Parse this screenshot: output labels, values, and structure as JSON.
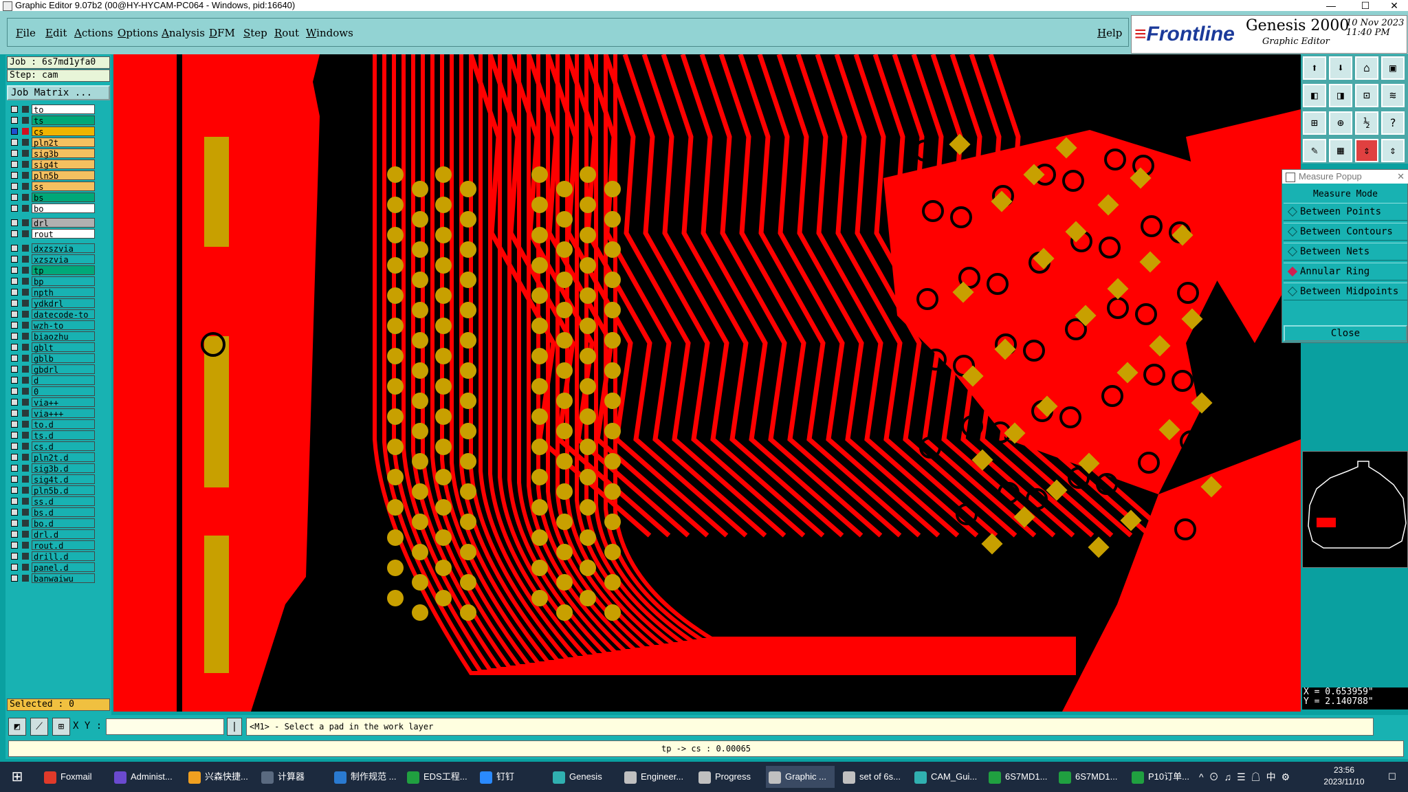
{
  "window": {
    "title": "Graphic Editor 9.07b2 (00@HY-HYCAM-PC064 - Windows, pid:16640)",
    "min": "—",
    "max": "☐",
    "close": "✕"
  },
  "menu": [
    "File",
    "Edit",
    "Actions",
    "Options",
    "Analysis",
    "DFM",
    "Step",
    "Rout",
    "Windows"
  ],
  "help": "Help",
  "brand": {
    "logo": "Frontline",
    "product": "Genesis 2000",
    "subtitle": "Graphic Editor",
    "date": "10 Nov 2023",
    "time": "11:40 PM"
  },
  "job": {
    "job_line": "Job : 6s7md1yfa0",
    "step_line": "Step: cam",
    "matrix_btn": "Job Matrix ..."
  },
  "layers_group1": [
    {
      "name": "to",
      "color": "#ffffff"
    },
    {
      "name": "ts",
      "color": "#00a878"
    },
    {
      "name": "cs",
      "color": "#f0b400",
      "active": true
    },
    {
      "name": "pln2t",
      "color": "#f4c060"
    },
    {
      "name": "sig3b",
      "color": "#f4c060"
    },
    {
      "name": "sig4t",
      "color": "#f4c060"
    },
    {
      "name": "pln5b",
      "color": "#f4c060"
    },
    {
      "name": "ss",
      "color": "#f4c060"
    },
    {
      "name": "bs",
      "color": "#00a878"
    },
    {
      "name": "bo",
      "color": "#ffffff"
    }
  ],
  "layers_group2": [
    {
      "name": "drl",
      "color": "#b0b0b0"
    },
    {
      "name": "rout",
      "color": "#ffffff"
    }
  ],
  "layers_group3": [
    {
      "name": "dxzszvia"
    },
    {
      "name": "xzszvia"
    },
    {
      "name": "tp",
      "color": "#00a878"
    },
    {
      "name": "bp"
    },
    {
      "name": "npth"
    },
    {
      "name": "ydkdrl"
    },
    {
      "name": "datecode-to"
    },
    {
      "name": "wzh-to"
    },
    {
      "name": "biaozhu"
    },
    {
      "name": "gblt"
    },
    {
      "name": "gblb"
    },
    {
      "name": "gbdrl"
    },
    {
      "name": "d"
    },
    {
      "name": "0"
    },
    {
      "name": "via++"
    },
    {
      "name": "via+++"
    },
    {
      "name": "to.d"
    },
    {
      "name": "ts.d"
    },
    {
      "name": "cs.d"
    },
    {
      "name": "pln2t.d"
    },
    {
      "name": "sig3b.d"
    },
    {
      "name": "sig4t.d"
    },
    {
      "name": "pln5b.d"
    },
    {
      "name": "ss.d"
    },
    {
      "name": "bs.d"
    },
    {
      "name": "bo.d"
    },
    {
      "name": "drl.d"
    },
    {
      "name": "rout.d"
    },
    {
      "name": "drill.d"
    },
    {
      "name": "panel.d"
    },
    {
      "name": "banwaiwu"
    }
  ],
  "selected": "Selected : 0",
  "measure": {
    "title": "Measure Popup",
    "mode_label": "Measure Mode",
    "options": [
      {
        "label": "Between Points",
        "selected": false
      },
      {
        "label": "Between Contours",
        "selected": false
      },
      {
        "label": "Between Nets",
        "selected": false
      },
      {
        "label": "Annular Ring",
        "selected": true
      },
      {
        "label": "Between Midpoints",
        "selected": false
      }
    ],
    "close": "Close"
  },
  "coords": {
    "x": "X = 0.653959\"",
    "y": "Y = 2.140788\""
  },
  "cmd": {
    "xy_label": "X Y :",
    "prompt": "<M1> - Select a pad in the work layer"
  },
  "status": "tp -> cs : 0.00065",
  "taskbar": [
    {
      "label": "Foxmail",
      "color": "#e03a2a"
    },
    {
      "label": "Administ...",
      "color": "#6a4acf"
    },
    {
      "label": "兴森快捷...",
      "color": "#f0a020"
    },
    {
      "label": "计算器",
      "color": "#5a6a80"
    },
    {
      "label": "制作规范 ...",
      "color": "#2a7ad0"
    },
    {
      "label": "EDS工程...",
      "color": "#20a040"
    },
    {
      "label": "钉钉",
      "color": "#2a8aff"
    },
    {
      "label": "Genesis",
      "color": "#30b0b0"
    },
    {
      "label": "Engineer...",
      "color": "#c0c0c0"
    },
    {
      "label": "Progress",
      "color": "#c0c0c0"
    },
    {
      "label": "Graphic ...",
      "color": "#c0c0c0",
      "active": true
    },
    {
      "label": "set of 6s...",
      "color": "#c0c0c0"
    },
    {
      "label": "CAM_Gui...",
      "color": "#30b0b0"
    },
    {
      "label": "6S7MD1...",
      "color": "#20a040"
    },
    {
      "label": "6S7MD1...",
      "color": "#20a040"
    },
    {
      "label": "P10订单...",
      "color": "#20a040"
    }
  ],
  "tray": {
    "ime": "中",
    "time": "23:56",
    "date": "2023/11/10"
  },
  "colors": {
    "copper": "#ff0000",
    "pad": "#c8a000",
    "background": "#000000",
    "accent": "#18b2b2"
  }
}
